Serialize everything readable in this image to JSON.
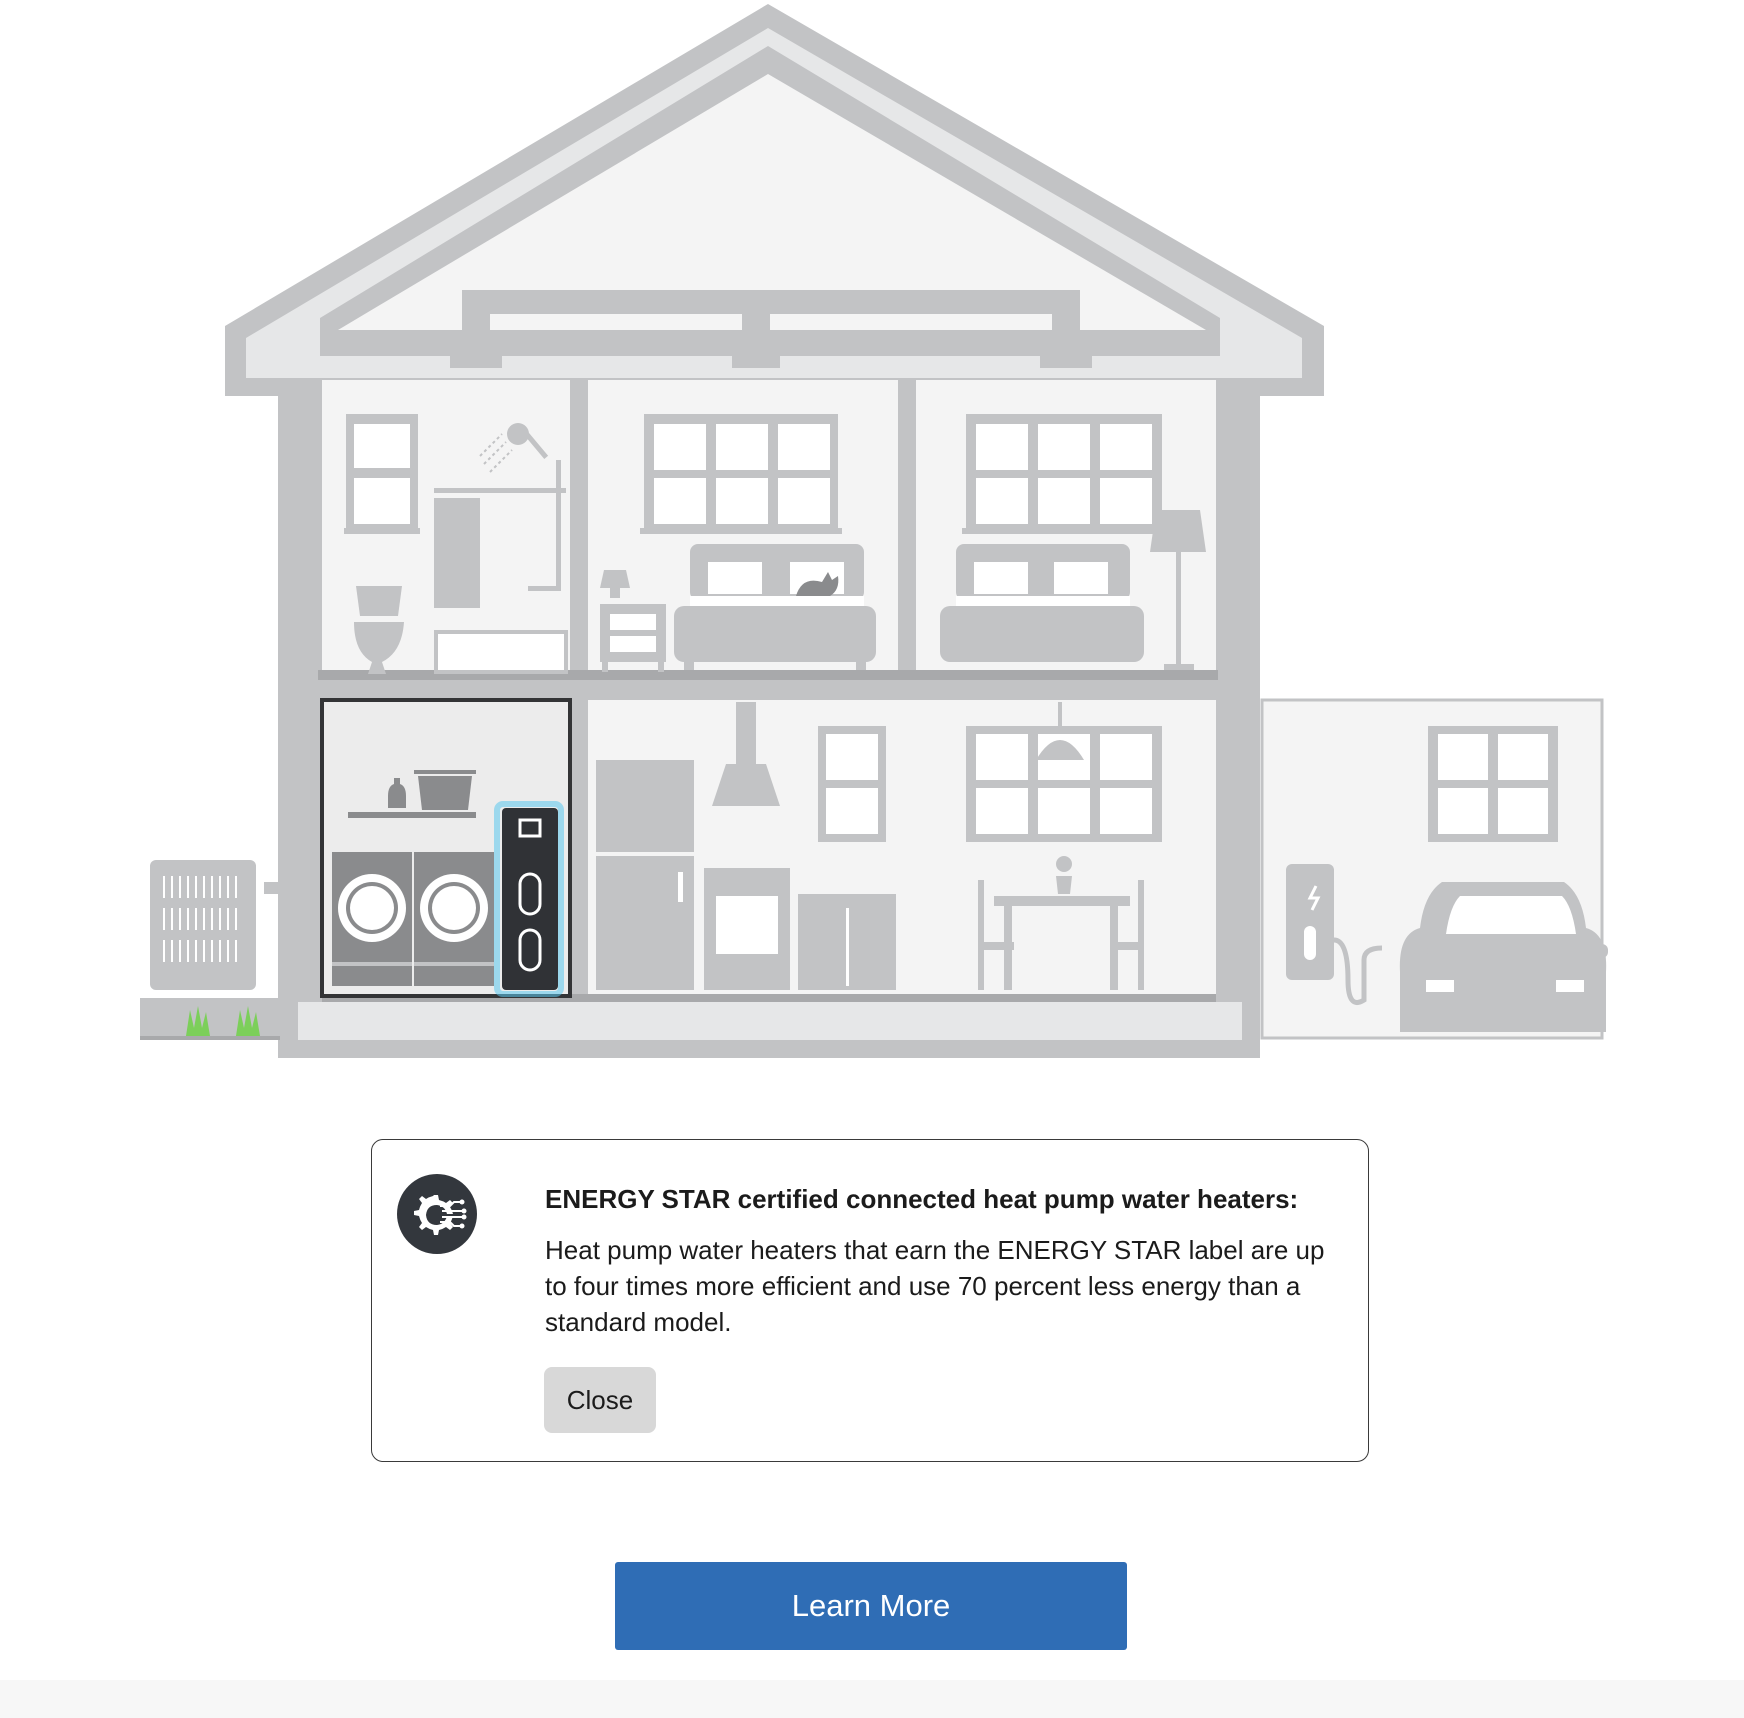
{
  "illustration": {
    "highlighted_appliance": "heat-pump-water-heater",
    "colors": {
      "structure": "#c2c3c5",
      "room_fill": "#f4f4f4",
      "appliance": "#c2c3c5",
      "appliance_dark": "#8a8b8d",
      "highlight_unit": "#303236",
      "highlight_glow": "#5bc8ef",
      "grass": "#7ccf5a"
    },
    "icons": [
      "shower-icon",
      "toilet-icon",
      "bed-icon",
      "cat-icon",
      "lamp-icon",
      "nightstand-icon",
      "washer-icon",
      "dryer-icon",
      "laundry-basket-icon",
      "detergent-bottle-icon",
      "water-heater-icon",
      "refrigerator-icon",
      "range-hood-icon",
      "stove-icon",
      "dining-table-icon",
      "chair-icon",
      "pendant-light-icon",
      "flower-pot-icon",
      "ev-charger-icon",
      "car-icon",
      "heat-pump-unit-icon"
    ]
  },
  "info_panel": {
    "icon": "smart-gear-circuit-icon",
    "icon_color": "#33373d",
    "title": "ENERGY STAR certified connected heat pump water heaters:",
    "body": "Heat pump water heaters that earn the ENERGY STAR label are up to four times more efficient and use 70 percent less energy than a standard model.",
    "close_label": "Close"
  },
  "actions": {
    "learn_more_label": "Learn More",
    "learn_more_color": "#2f6db5"
  }
}
